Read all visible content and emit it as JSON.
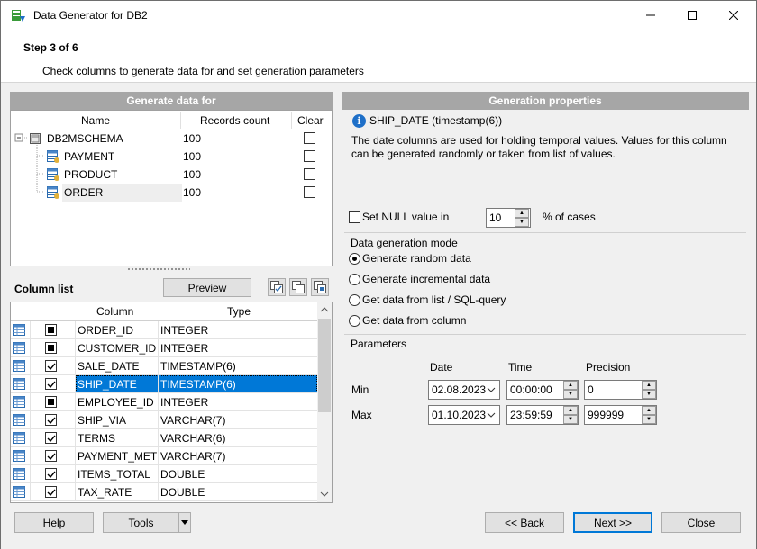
{
  "window": {
    "title": "Data Generator for DB2"
  },
  "header": {
    "step": "Step 3 of 6",
    "description": "Check columns to generate data for and set generation parameters"
  },
  "generate_panel": {
    "title": "Generate data for",
    "col_name": "Name",
    "col_records": "Records count",
    "col_clear": "Clear",
    "rows": [
      {
        "name": "DB2MSCHEMA",
        "count": "100"
      },
      {
        "name": "PAYMENT",
        "count": "100"
      },
      {
        "name": "PRODUCT",
        "count": "100"
      },
      {
        "name": "ORDER",
        "count": "100"
      }
    ]
  },
  "column_list": {
    "label": "Column list",
    "preview_label": "Preview",
    "col_column": "Column",
    "col_type": "Type",
    "rows": [
      {
        "name": "ORDER_ID",
        "type": "INTEGER",
        "state": "filled"
      },
      {
        "name": "CUSTOMER_ID",
        "type": "INTEGER",
        "state": "filled"
      },
      {
        "name": "SALE_DATE",
        "type": "TIMESTAMP(6)",
        "state": "checked"
      },
      {
        "name": "SHIP_DATE",
        "type": "TIMESTAMP(6)",
        "state": "checked"
      },
      {
        "name": "EMPLOYEE_ID",
        "type": "INTEGER",
        "state": "filled"
      },
      {
        "name": "SHIP_VIA",
        "type": "VARCHAR(7)",
        "state": "checked"
      },
      {
        "name": "TERMS",
        "type": "VARCHAR(6)",
        "state": "checked"
      },
      {
        "name": "PAYMENT_METHOD",
        "type": "VARCHAR(7)",
        "state": "checked"
      },
      {
        "name": "ITEMS_TOTAL",
        "type": "DOUBLE",
        "state": "checked"
      },
      {
        "name": "TAX_RATE",
        "type": "DOUBLE",
        "state": "checked"
      }
    ]
  },
  "properties": {
    "title": "Generation properties",
    "field": "SHIP_DATE (timestamp(6))",
    "description": "The date columns are used for holding temporal values. Values for this column can be generated randomly or taken from list of values.",
    "null_label": "Set NULL value in",
    "null_value": "10",
    "null_suffix": "% of cases",
    "mode_title": "Data generation mode",
    "modes": [
      "Generate random data",
      "Generate incremental data",
      "Get data from list / SQL-query",
      "Get data from column"
    ],
    "params_title": "Parameters",
    "col_date": "Date",
    "col_time": "Time",
    "col_precision": "Precision",
    "min_label": "Min",
    "max_label": "Max",
    "min_date": "02.08.2023",
    "min_time": "00:00:00",
    "min_precision": "0",
    "max_date": "01.10.2023",
    "max_time": "23:59:59",
    "max_precision": "999999"
  },
  "footer": {
    "help": "Help",
    "tools": "Tools",
    "back": "<< Back",
    "next": "Next >>",
    "close": "Close"
  },
  "colors": {
    "accent": "#0078d7",
    "panel_header": "#a6a6a6"
  }
}
